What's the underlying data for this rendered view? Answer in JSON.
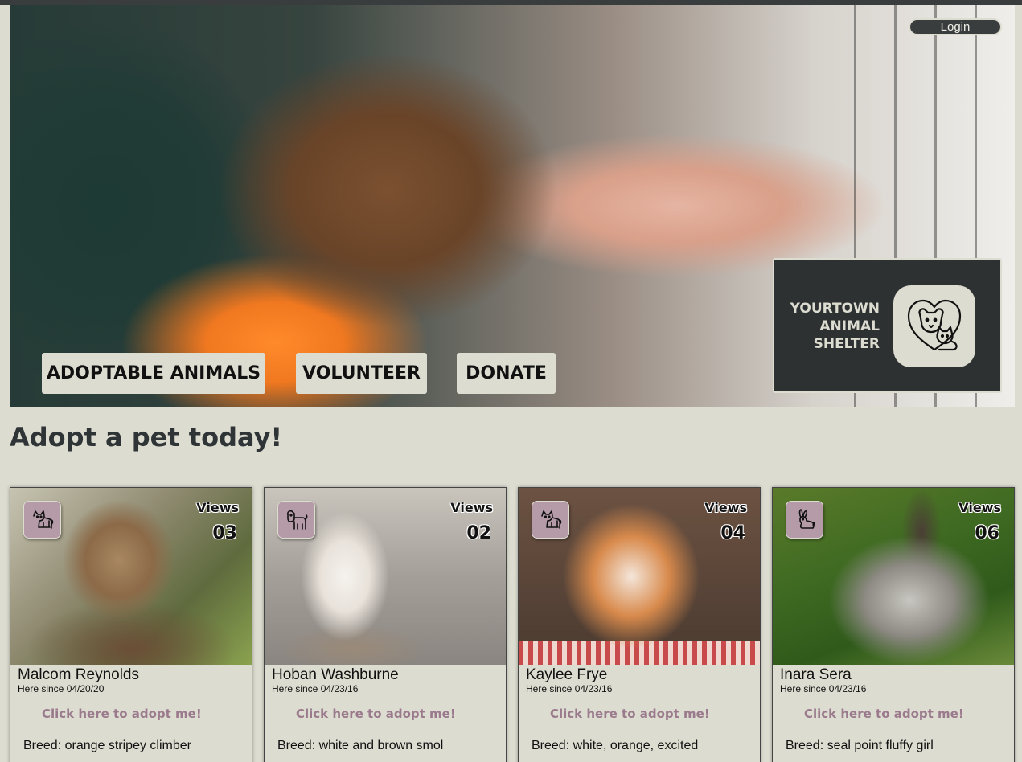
{
  "header": {
    "login_label": "Login"
  },
  "nav": {
    "adoptable_label": "ADOPTABLE ANIMALS",
    "volunteer_label": "VOLUNTEER",
    "donate_label": "DONATE"
  },
  "brand": {
    "line1": "YOURTOWN",
    "line2": "ANIMAL",
    "line3": "SHELTER",
    "logo_icon": "dog-and-cat-heart-icon"
  },
  "page": {
    "title": "Adopt a pet today!"
  },
  "pets": [
    {
      "type_icon": "cat-icon",
      "views_label": "Views",
      "views": "03",
      "name": "Malcom Reynolds",
      "since": "Here since 04/20/20",
      "adopt_label": "Click here to adopt me!",
      "breed": "Breed: orange stripey climber"
    },
    {
      "type_icon": "dog-icon",
      "views_label": "Views",
      "views": "02",
      "name": "Hoban Washburne",
      "since": "Here since 04/23/16",
      "adopt_label": "Click here to adopt me!",
      "breed": "Breed: white and brown smol"
    },
    {
      "type_icon": "cat-icon",
      "views_label": "Views",
      "views": "04",
      "name": "Kaylee Frye",
      "since": "Here since 04/23/16",
      "adopt_label": "Click here to adopt me!",
      "breed": "Breed: white, orange, excited"
    },
    {
      "type_icon": "rabbit-icon",
      "views_label": "Views",
      "views": "06",
      "name": "Inara Sera",
      "since": "Here since 04/23/16",
      "adopt_label": "Click here to adopt me!",
      "breed": "Breed: seal point fluffy girl"
    }
  ],
  "colors": {
    "page_bg": "#dcdcd0",
    "dark": "#2e3132",
    "badge": "#b59aa8",
    "link": "#9a7a8c"
  }
}
